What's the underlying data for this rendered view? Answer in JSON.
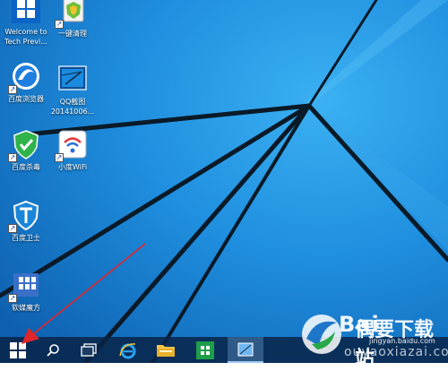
{
  "desktop": {
    "icons": [
      {
        "name": "welcome-tech-preview",
        "label": "Welcome to\nTech Previ..."
      },
      {
        "name": "yijian-qingli",
        "label": "一键清理"
      },
      {
        "name": "baidu-browser",
        "label": "百度浏览器"
      },
      {
        "name": "qq-screenshot",
        "label": "QQ截图\n20141006..."
      },
      {
        "name": "baidu-antivirus",
        "label": "百度杀毒"
      },
      {
        "name": "xiaodu-wifi",
        "label": "小度WiFi"
      },
      {
        "name": "baidu-guard",
        "label": "百度卫士"
      },
      {
        "name": "ruanmei-mofang",
        "label": "软媒魔方"
      }
    ]
  },
  "taskbar": {
    "items": [
      {
        "name": "start-button",
        "icon": "windows-logo-icon"
      },
      {
        "name": "search-button",
        "icon": "search-icon"
      },
      {
        "name": "task-view-button",
        "icon": "task-view-icon"
      },
      {
        "name": "ie-button",
        "icon": "internet-explorer-icon"
      },
      {
        "name": "file-explorer-button",
        "icon": "folder-icon"
      },
      {
        "name": "store-button",
        "icon": "store-icon"
      },
      {
        "name": "qq-screenshot-app-button",
        "icon": "screenshot-app-icon"
      }
    ]
  },
  "watermark": {
    "main": "偶要下载站",
    "url": "ouyaoxiazai.com",
    "baidu_url": "jingyan.baidu.com",
    "baidu_logo": "Bai"
  },
  "colors": {
    "wallpaper_blue": "#1f8fdf",
    "taskbar": "#0b2a4d",
    "annotation_arrow": "#e0262b"
  }
}
